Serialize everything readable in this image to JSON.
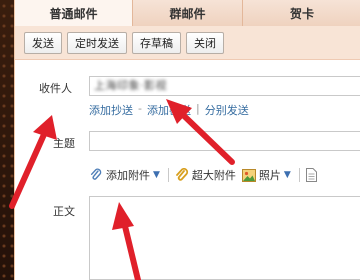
{
  "tabs": [
    {
      "label": "普通邮件",
      "active": true
    },
    {
      "label": "群邮件",
      "active": false
    },
    {
      "label": "贺卡",
      "active": false
    }
  ],
  "toolbar": {
    "send": "发送",
    "scheduled_send": "定时发送",
    "save_draft": "存草稿",
    "close": "关闭"
  },
  "form": {
    "recipient_label": "收件人",
    "recipient_value": "上海印象·影视",
    "add_cc": "添加抄送",
    "link_sep": "-",
    "add_bcc": "添加密送",
    "bar_sep": "|",
    "separate_send": "分别发送",
    "subject_label": "主题",
    "body_label": "正文"
  },
  "attachments": {
    "add_attachment": "添加附件",
    "large_attachment": "超大附件",
    "photo": "照片"
  },
  "colors": {
    "accent_arrow": "#e0202a",
    "link": "#356ca0",
    "tab_active_bg": "#fdf5ef",
    "toolbar_bg": "#f8e4d6"
  },
  "icons": [
    "paperclip-icon",
    "large-attachment-icon",
    "photo-icon",
    "document-icon"
  ]
}
